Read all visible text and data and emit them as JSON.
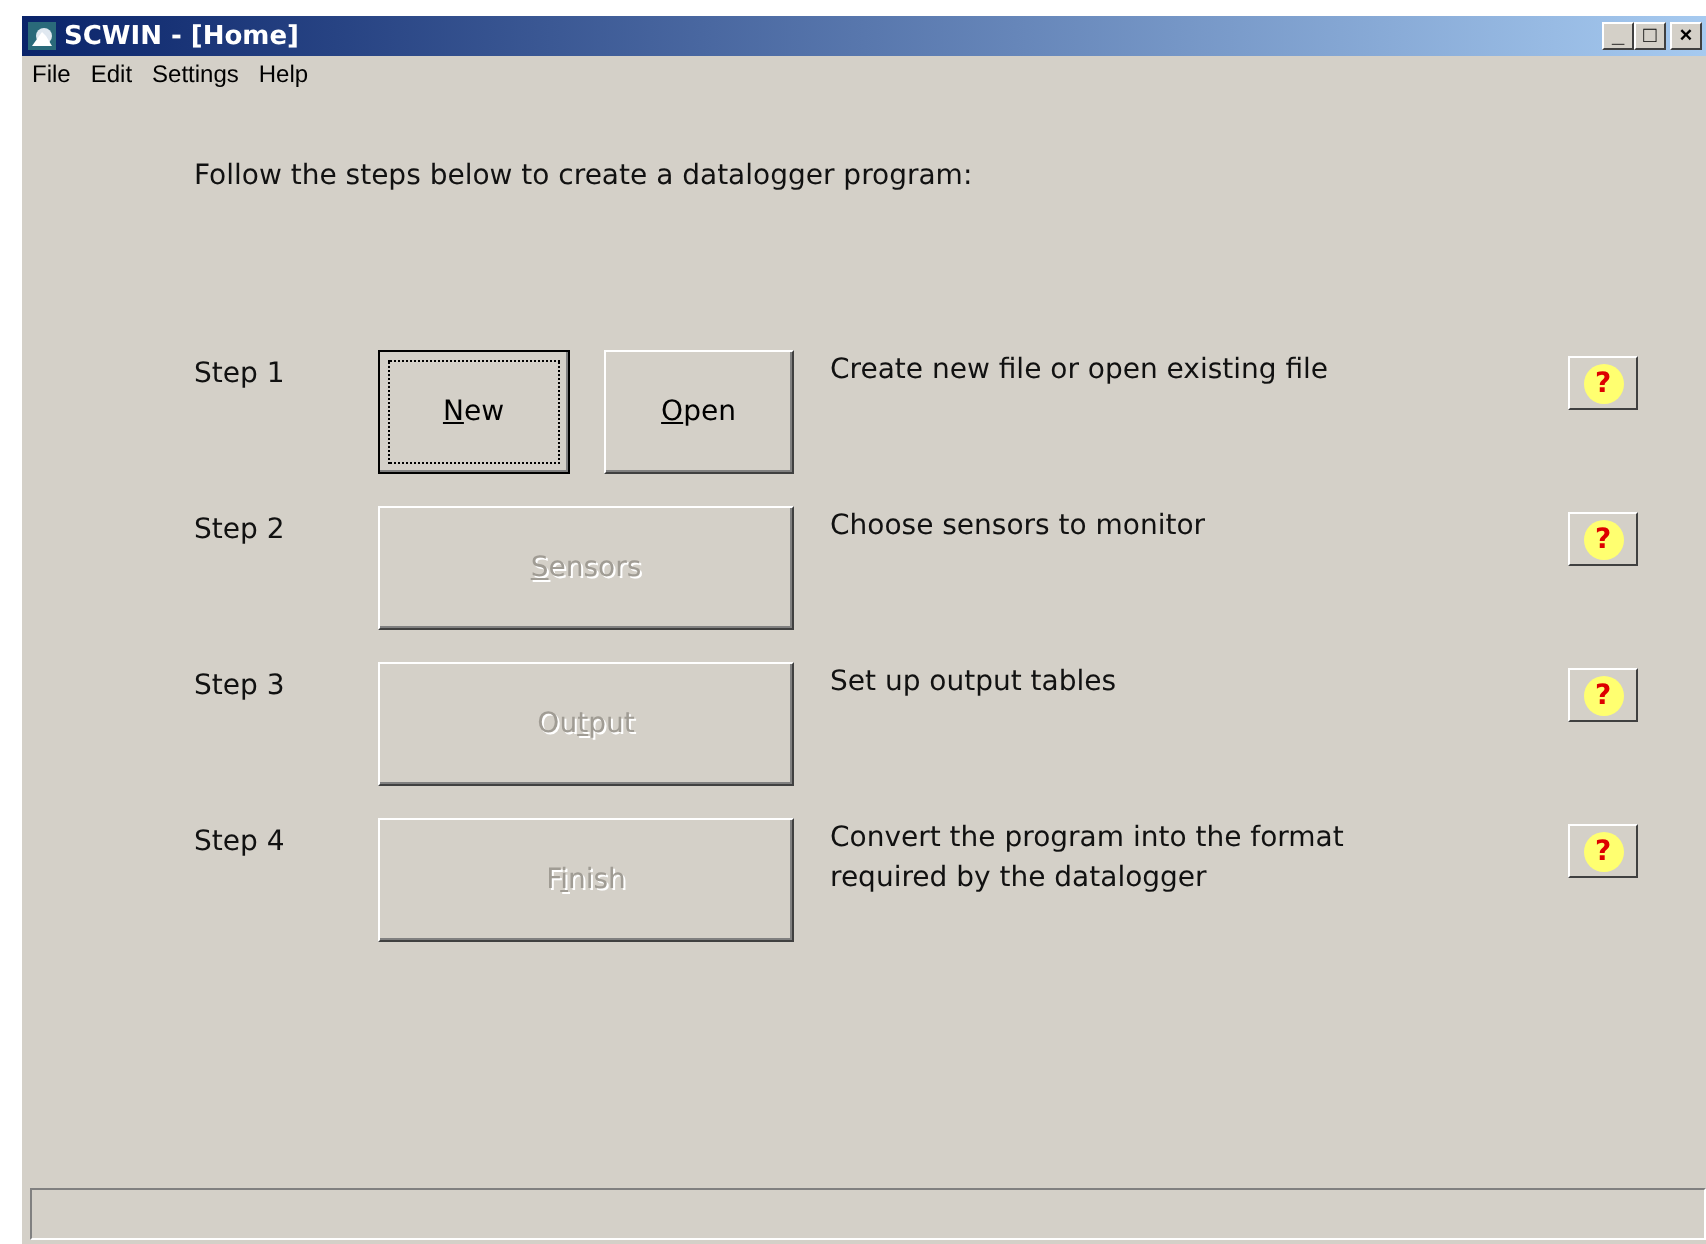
{
  "window": {
    "title": "SCWIN - [Home]",
    "controls": [
      "_",
      "□",
      "×"
    ]
  },
  "menu": [
    "File",
    "Edit",
    "Settings",
    "Help"
  ],
  "intro": "Follow the steps below to create a datalogger program:",
  "steps": [
    {
      "label": "Step 1",
      "buttons": [
        {
          "key": "N",
          "after": "ew",
          "disabled": false,
          "focused": true
        },
        {
          "key": "O",
          "after": "pen",
          "disabled": false,
          "focused": false
        }
      ],
      "description": [
        "Create new file or open existing file"
      ],
      "help": "?"
    },
    {
      "label": "Step 2",
      "buttons": [
        {
          "key": "S",
          "after": "ensors",
          "disabled": true,
          "focused": false
        }
      ],
      "description": [
        "Choose sensors to monitor"
      ],
      "help": "?"
    },
    {
      "label": "Step 3",
      "buttons": [
        {
          "before": "Ou",
          "key": "t",
          "after": "put",
          "disabled": true,
          "focused": false
        }
      ],
      "description": [
        "Set up output tables"
      ],
      "help": "?"
    },
    {
      "label": "Step 4",
      "buttons": [
        {
          "before": "F",
          "key": "i",
          "after": "nish",
          "disabled": true,
          "focused": false
        }
      ],
      "description": [
        "Convert the program into the format",
        "required by the datalogger"
      ],
      "help": "?"
    }
  ]
}
